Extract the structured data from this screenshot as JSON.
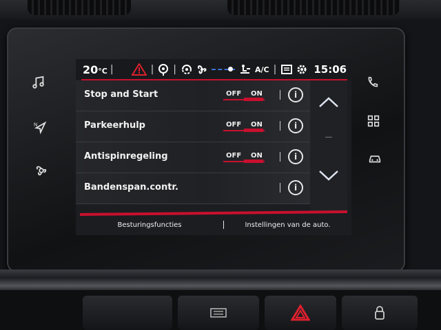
{
  "status_bar": {
    "temperature": "20",
    "temperature_unit": "°C",
    "ac_label": "A/C",
    "time": "15:06",
    "icons": [
      "hazard-warning-icon",
      "parking-sensor-icon",
      "recirculation-icon",
      "fan-icon",
      "fan-speed-indicator",
      "air-flow-icon",
      "ac-icon",
      "rear-defrost-icon",
      "settings-icon"
    ]
  },
  "settings": [
    {
      "label": "Stop and Start",
      "toggle": {
        "off": "OFF",
        "on": "ON",
        "state": "on"
      },
      "info_icon": "info-icon"
    },
    {
      "label": "Parkeerhulp",
      "toggle": {
        "off": "OFF",
        "on": "ON",
        "state": "on"
      },
      "info_icon": "info-icon"
    },
    {
      "label": "Antispinregeling",
      "toggle": {
        "off": "OFF",
        "on": "ON",
        "state": "on"
      },
      "info_icon": "info-icon"
    },
    {
      "label": "Bandenspan.contr.",
      "toggle": null,
      "info_icon": "info-icon"
    }
  ],
  "info_glyph": "i",
  "scroll": {
    "up_icon": "chevron-up-icon",
    "down_icon": "chevron-down-icon"
  },
  "tabs": [
    {
      "label": "Besturingsfuncties"
    },
    {
      "label": "Instellingen van de auto."
    }
  ],
  "hardware_buttons": {
    "left": [
      "music-note-icon",
      "navigation-icon",
      "climate-fan-icon"
    ],
    "right": [
      "phone-icon",
      "apps-grid-icon",
      "car-icon"
    ]
  },
  "colors": {
    "accent": "#c8102e",
    "fan_indicator": "#3d6fd6",
    "screen_bg": "#1c1d21"
  }
}
